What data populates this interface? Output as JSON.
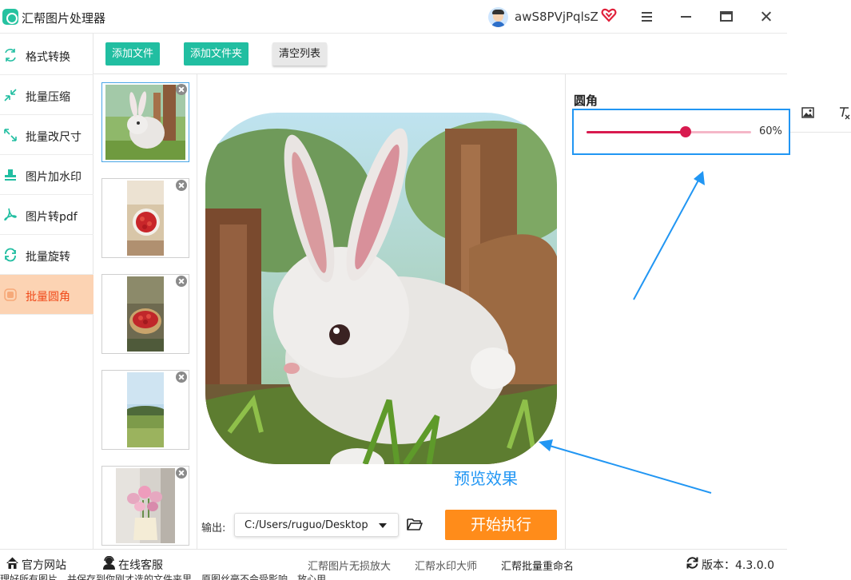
{
  "app": {
    "title": "汇帮图片处理器",
    "username": "awS8PVjPqlsZ"
  },
  "sidebar": {
    "items": [
      {
        "label": "格式转换",
        "icon": "format-convert-icon"
      },
      {
        "label": "批量压缩",
        "icon": "compress-icon"
      },
      {
        "label": "批量改尺寸",
        "icon": "resize-icon"
      },
      {
        "label": "图片加水印",
        "icon": "watermark-icon"
      },
      {
        "label": "图片转pdf",
        "icon": "pdf-icon"
      },
      {
        "label": "批量旋转",
        "icon": "rotate-icon"
      },
      {
        "label": "批量圆角",
        "icon": "rounded-corner-icon",
        "active": true
      }
    ]
  },
  "toolbar": {
    "add_file": "添加文件",
    "add_folder": "添加文件夹",
    "clear_list": "清空列表"
  },
  "preview": {
    "label": "预览效果"
  },
  "output": {
    "label": "输出:",
    "path": "C:/Users/ruguo/Desktop"
  },
  "actions": {
    "start": "开始执行"
  },
  "settings": {
    "title": "圆角",
    "radius_percent": 60,
    "radius_text": "60%"
  },
  "bottom": {
    "official_site": "官方网站",
    "online_service": "在线客服",
    "links": [
      "汇帮图片无损放大",
      "汇帮水印大师",
      "汇帮批量重命名"
    ],
    "version_label": "版本：",
    "version": "4.3.0.0",
    "hint": "理好所有图片，并保存到你刚才选的文件夹里。原图丝毫不会受影响，放心用"
  },
  "colors": {
    "accent_green": "#21bea1",
    "start_orange": "#ff8c1a",
    "slider_red": "#d81b4f",
    "arrow_blue": "#2196f3",
    "active_bg": "#fcd3b3",
    "active_text": "#f04a1a"
  }
}
